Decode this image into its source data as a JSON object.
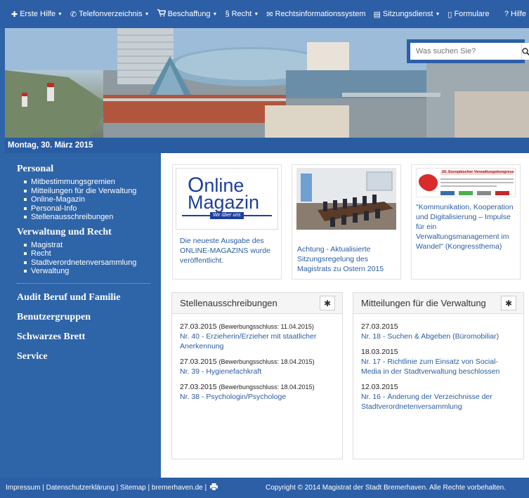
{
  "nav": {
    "items": [
      {
        "icon": "plus-icon",
        "label": "Erste Hilfe",
        "dropdown": true
      },
      {
        "icon": "phone-icon",
        "label": "Telefonverzeichnis",
        "dropdown": true
      },
      {
        "icon": "cart-icon",
        "label": "Beschaffung",
        "dropdown": true
      },
      {
        "icon": "section-icon",
        "label": "Recht",
        "dropdown": true
      },
      {
        "icon": "envelope-icon",
        "label": "Rechtsinformationssystem",
        "dropdown": false
      },
      {
        "icon": "book-icon",
        "label": "Sitzungsdienst",
        "dropdown": true
      },
      {
        "icon": "file-icon",
        "label": "Formulare",
        "dropdown": false
      }
    ],
    "help": "? Hilfe"
  },
  "search": {
    "placeholder": "Was suchen Sie?"
  },
  "date": "Montag, 30. März 2015",
  "sidebar": {
    "sections": [
      {
        "title": "Personal",
        "items": [
          "Mitbestimmungsgremien",
          "Mitteilungen für die Verwaltung",
          "Online-Magazin",
          "Personal-Info",
          "Stellenausschreibungen"
        ]
      },
      {
        "title": "Verwaltung und Recht",
        "items": [
          "Magistrat",
          "Recht",
          "Stadtverordnetenversammlung",
          "Verwaltung"
        ]
      }
    ],
    "links": [
      "Audit Beruf und Familie",
      "Benutzergruppen",
      "Schwarzes Brett",
      "Service"
    ]
  },
  "teasers": [
    {
      "text": "Die neueste Ausgabe des ONLINE-MAGAZINS wurde veröffentlicht.",
      "logo_line1": "nline",
      "logo_line2": "Magazin",
      "logo_sub": "Wir über uns"
    },
    {
      "text": "Achtung - Aktualisierte Sitzungsregelung des Magistrats zu Ostern 2015"
    },
    {
      "text": "\"Kommunikation, Kooperation und Digitalisierung – Impulse für ein Verwaltungsmanagement im Wandel\" (Kongressthema)",
      "banner": "20. Europäischer Verwaltungskongress 2015"
    }
  ],
  "panels": {
    "jobs": {
      "title": "Stellenausschreibungen",
      "entries": [
        {
          "date": "27.03.2015",
          "note": "(Bewerbungsschluss: 11.04.2015)",
          "link": "Nr. 40 - Erzieherin/Erzieher mit staatlicher Anerkennung"
        },
        {
          "date": "27.03.2015",
          "note": "(Bewerbungsschluss: 18.04.2015)",
          "link": "Nr. 39 - Hygienefachkraft"
        },
        {
          "date": "27.03.2015",
          "note": "(Bewerbungsschluss: 18.04.2015)",
          "link": "Nr. 38 - Psychologin/Psychologe"
        }
      ]
    },
    "notices": {
      "title": "Mitteilungen für die Verwaltung",
      "entries": [
        {
          "date": "27.03.2015",
          "link": "Nr. 18 - Suchen & Abgeben (Büromobiliar)"
        },
        {
          "date": "18.03.2015",
          "link": "Nr. 17 - Richtlinie zum Einsatz von Social-Media in der Stadtverwaltung beschlossen"
        },
        {
          "date": "12.03.2015",
          "link": "Nr. 16 - Änderung der Verzeichnisse der Stadtverordnetenversammlung"
        }
      ]
    }
  },
  "footer": {
    "links": "Impressum | Datenschutzerklärung | Sitemap | bremerhaven.de |",
    "print_icon": "printer-icon",
    "copyright": "Copyright © 2014 Magistrat der Stadt Bremerhaven. Alle Rechte vorbehalten."
  },
  "colors": {
    "brand": "#2d5fa6",
    "link": "#2a5ca2"
  }
}
